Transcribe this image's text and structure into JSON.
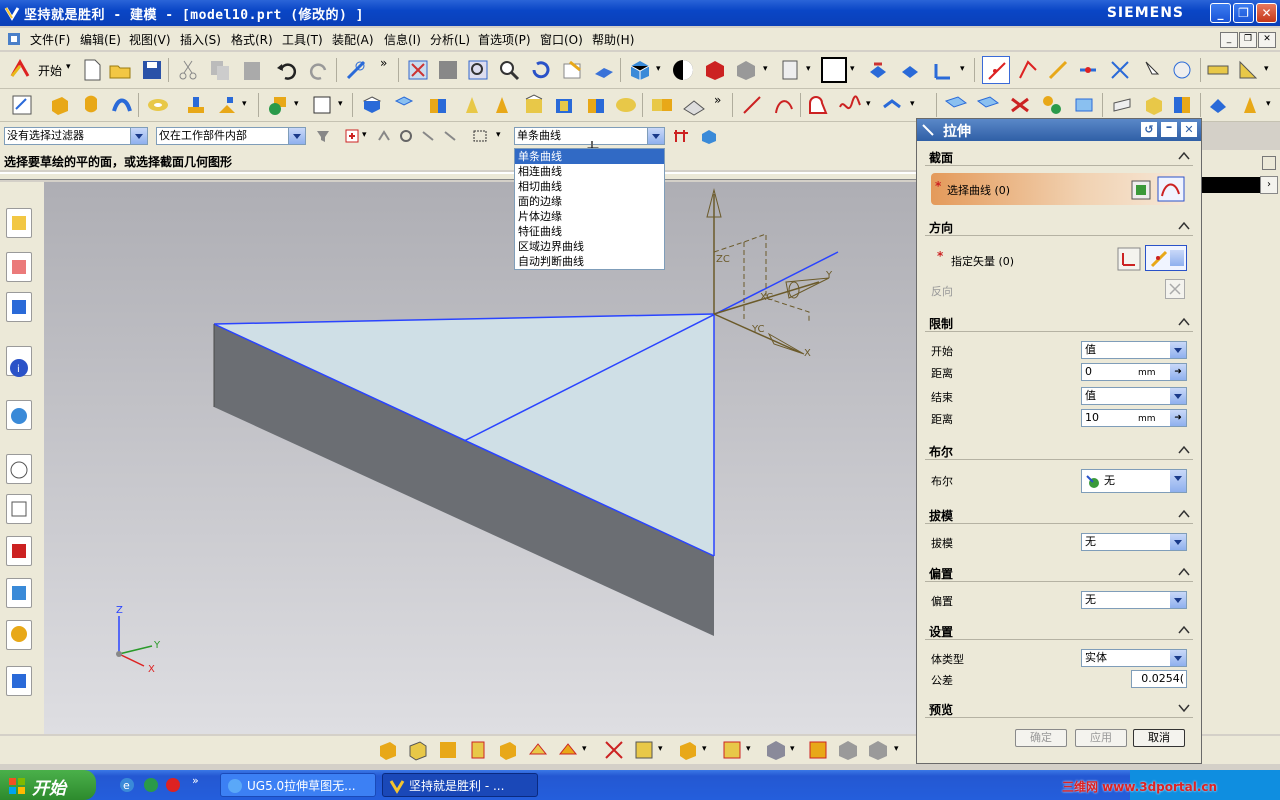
{
  "window": {
    "title": "坚持就是胜利 - 建模 - [model10.prt (修改的) ]",
    "brand": "SIEMENS"
  },
  "menu": {
    "items": [
      "文件(F)",
      "编辑(E)",
      "视图(V)",
      "插入(S)",
      "格式(R)",
      "工具(T)",
      "装配(A)",
      "信息(I)",
      "分析(L)",
      "首选项(P)",
      "窗口(O)",
      "帮助(H)"
    ]
  },
  "toolbar": {
    "start_label": "开始"
  },
  "filters": {
    "type_filter": "没有选择过滤器",
    "scope_filter": "仅在工作部件内部",
    "curve_rule": "单条曲线"
  },
  "curve_rule_options": [
    {
      "label": "单条曲线",
      "selected": true
    },
    {
      "label": "相连曲线",
      "selected": false
    },
    {
      "label": "相切曲线",
      "selected": false
    },
    {
      "label": "面的边缘",
      "selected": false
    },
    {
      "label": "片体边缘",
      "selected": false
    },
    {
      "label": "特征曲线",
      "selected": false
    },
    {
      "label": "区域边界曲线",
      "selected": false
    },
    {
      "label": "自动判断曲线",
      "selected": false
    }
  ],
  "cue_line": "选择要草绘的平的面，或选择截面几何图形",
  "viewport": {
    "triad_labels": {
      "zc": "ZC",
      "yc": "YC",
      "xc": "XC",
      "y": "Y",
      "x": "X"
    },
    "mini_axes": {
      "z": "Z",
      "y": "Y",
      "x": "X"
    }
  },
  "dialog": {
    "title": "拉伸",
    "section": {
      "title": "截面",
      "select_curve": "选择曲线 (0)"
    },
    "direction": {
      "title": "方向",
      "specify_vector": "指定矢量 (0)",
      "reverse": "反向"
    },
    "limits": {
      "title": "限制",
      "start_label": "开始",
      "start_value": "值",
      "start_dist_label": "距离",
      "start_dist": "0",
      "end_label": "结束",
      "end_value": "值",
      "end_dist_label": "距离",
      "end_dist": "10",
      "unit": "mm"
    },
    "boolean": {
      "title": "布尔",
      "label": "布尔",
      "value": "无"
    },
    "draft": {
      "title": "拔模",
      "label": "拔模",
      "value": "无"
    },
    "offset": {
      "title": "偏置",
      "label": "偏置",
      "value": "无"
    },
    "settings": {
      "title": "设置",
      "body_type_label": "体类型",
      "body_type": "实体",
      "tolerance_label": "公差",
      "tolerance": "0.0254("
    },
    "preview": {
      "title": "预览"
    },
    "buttons": {
      "ok": "确定",
      "apply": "应用",
      "cancel": "取消"
    }
  },
  "taskbar": {
    "start": "开始",
    "task1": "UG5.0拉伸草图无...",
    "task2": "坚持就是胜利 - ...",
    "watermark": "三维网 www.3dportal.cn"
  }
}
